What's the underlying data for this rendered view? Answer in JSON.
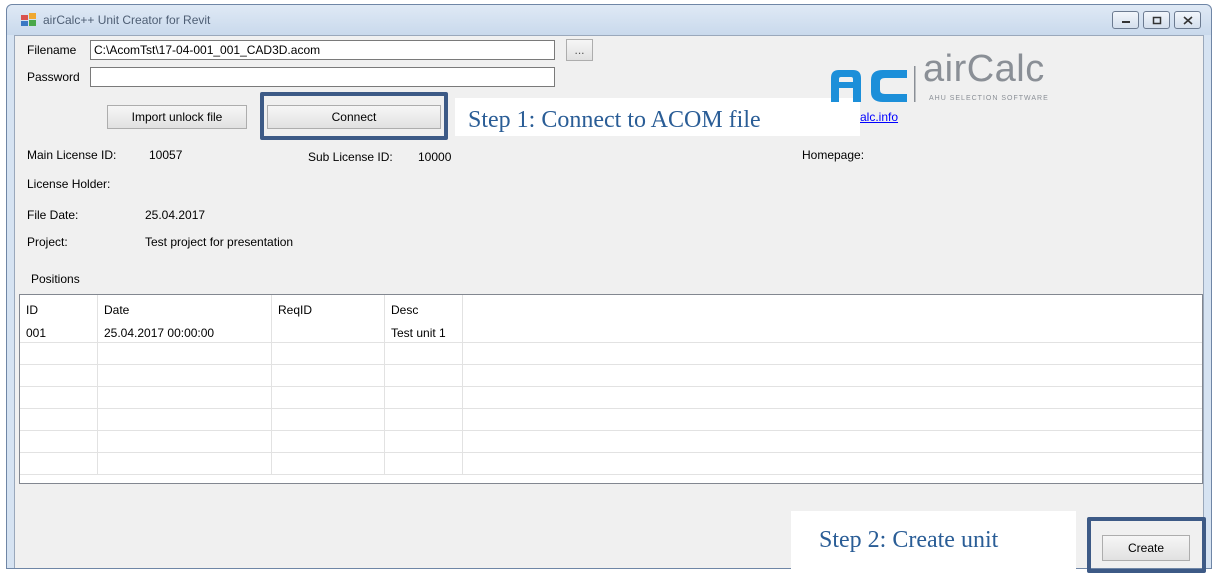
{
  "window": {
    "title": "airCalc++ Unit Creator for Revit"
  },
  "form": {
    "filename_label": "Filename",
    "filename_value": "C:\\AcomTst\\17-04-001_001_CAD3D.acom",
    "browse_label": "...",
    "password_label": "Password",
    "password_value": "",
    "import_unlock_label": "Import unlock file",
    "connect_label": "Connect"
  },
  "logo": {
    "brand_mark": "AC",
    "brand_name": "airCalc",
    "tagline": "AHU SELECTION SOFTWARE",
    "link_fragment": "alc.info",
    "homepage_label": "Homepage:"
  },
  "info": {
    "main_license_label": "Main License ID:",
    "main_license_value": "10057",
    "sub_license_label": "Sub License ID:",
    "sub_license_value": "10000",
    "license_holder_label": "License Holder:",
    "file_date_label": "File Date:",
    "file_date_value": "25.04.2017",
    "project_label": "Project:",
    "project_value": "Test project for presentation",
    "positions_label": "Positions"
  },
  "grid": {
    "columns": [
      "ID",
      "Date",
      "ReqID",
      "Desc"
    ],
    "rows": [
      {
        "id": "001",
        "date": "25.04.2017 00:00:00",
        "reqid": "",
        "desc": "Test unit 1"
      }
    ]
  },
  "callouts": {
    "step1": "Step 1: Connect to ACOM file",
    "step2": "Step 2: Create unit"
  },
  "footer": {
    "create_label": "Create"
  },
  "colors": {
    "logo_blue": "#1c8fd9",
    "logo_gray": "#8a8f96",
    "callout_text": "#2a5d96",
    "highlight_border": "#3d5a86"
  }
}
